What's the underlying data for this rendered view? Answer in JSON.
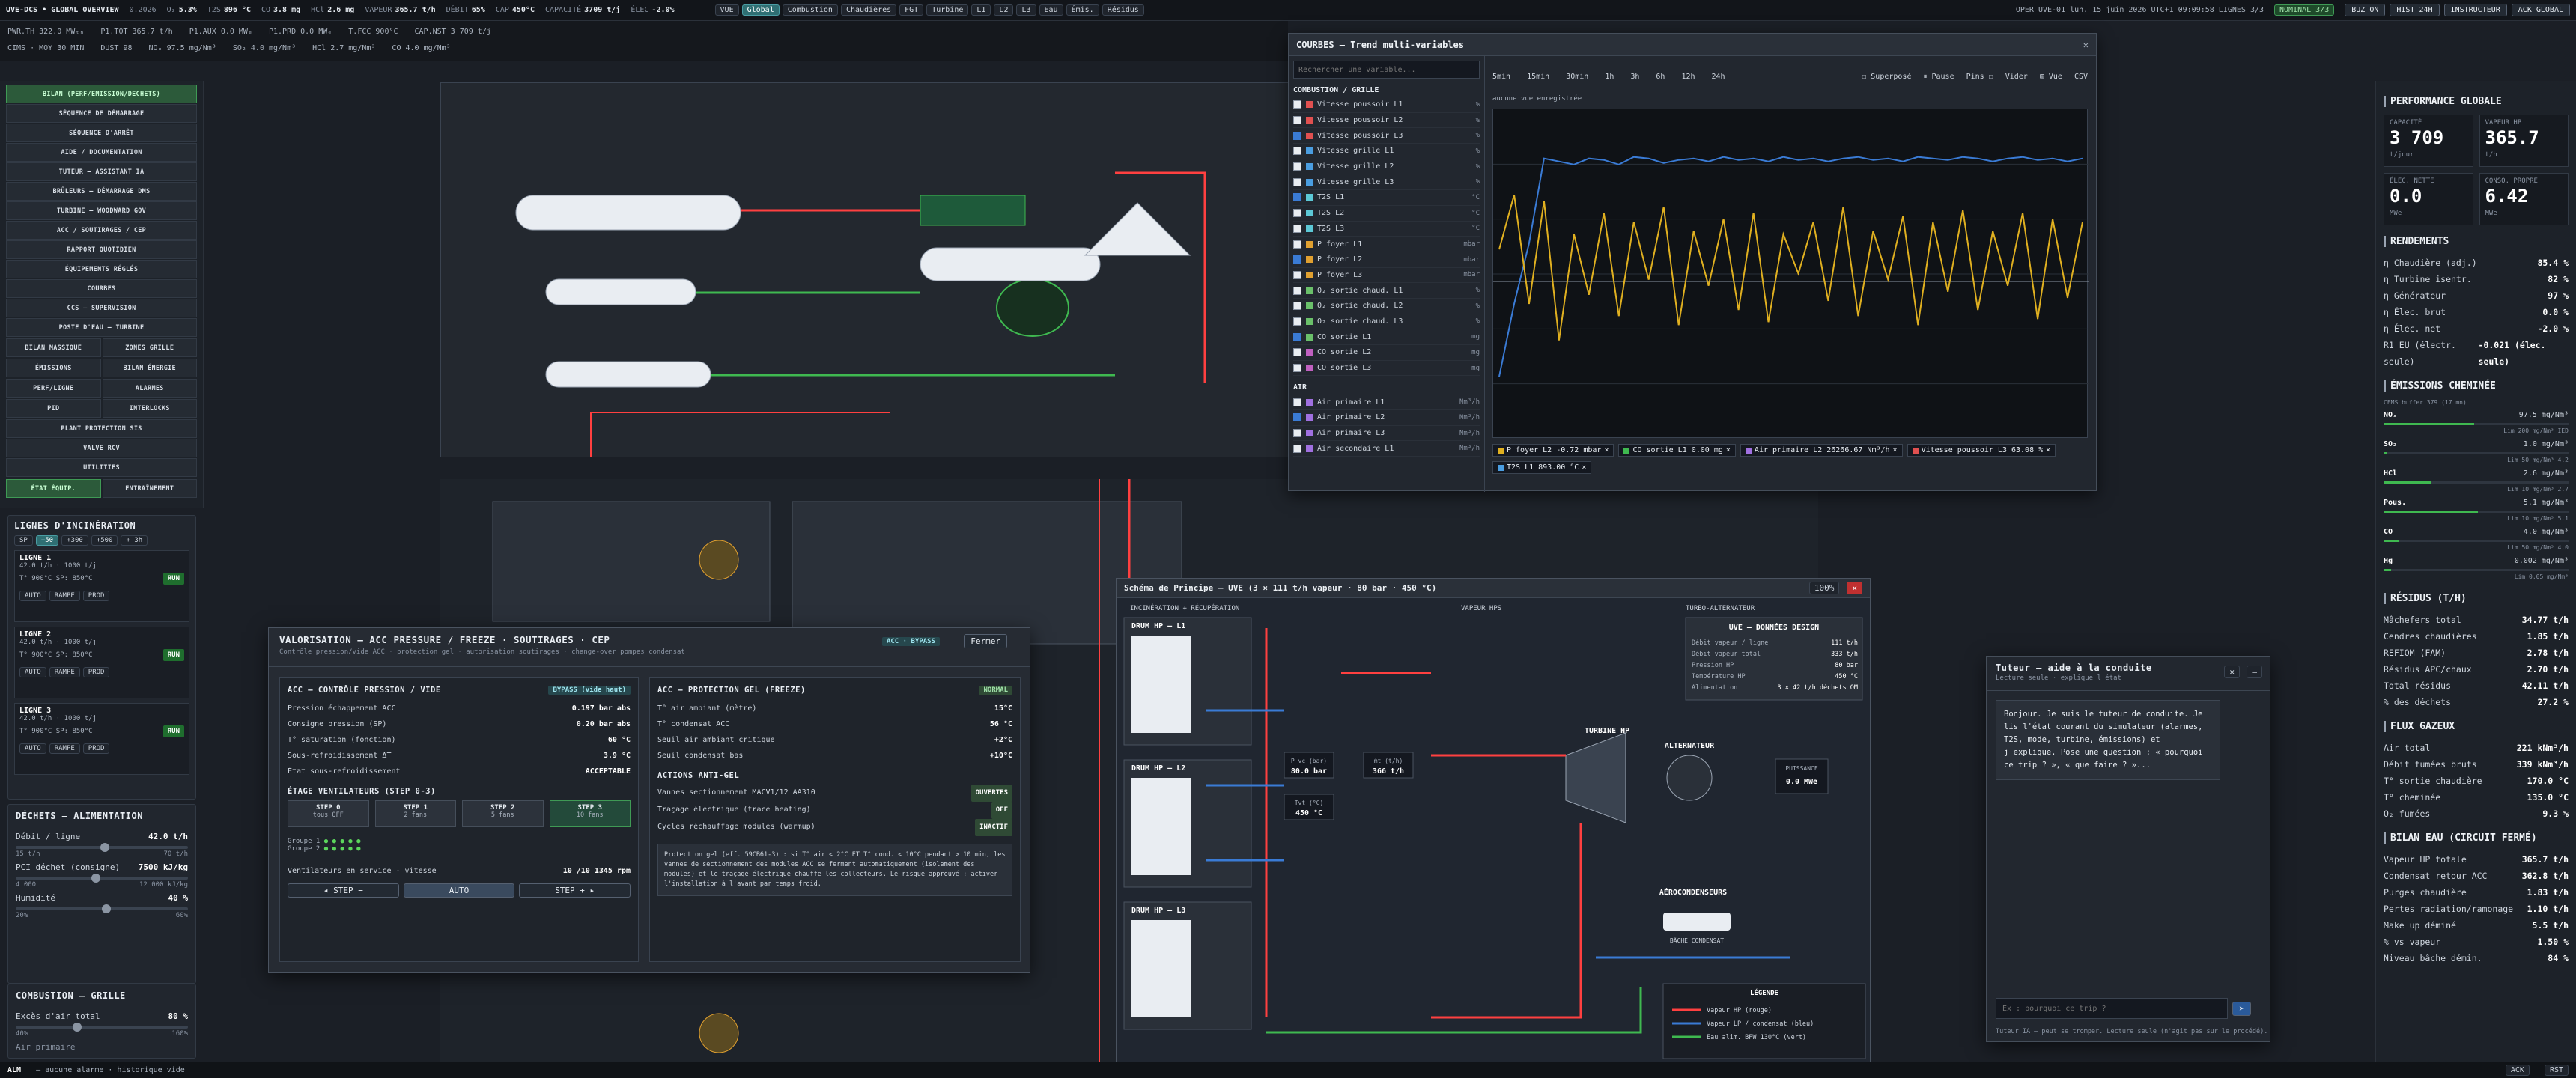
{
  "topbar": {
    "title": "UVE-DCS • GLOBAL OVERVIEW",
    "version": "0.2026",
    "kpis": [
      {
        "k": "O₂",
        "v": "5.3%"
      },
      {
        "k": "T2S",
        "v": "896 °C"
      },
      {
        "k": "CO",
        "v": "3.8 mg"
      },
      {
        "k": "HCl",
        "v": "2.6 mg"
      },
      {
        "k": "VAPEUR",
        "v": "365.7 t/h"
      },
      {
        "k": "DÉBIT",
        "v": "65%"
      },
      {
        "k": "CAP",
        "v": "450°C"
      },
      {
        "k": "CAPACITÉ",
        "v": "3709 t/j"
      },
      {
        "k": "ÉLEC",
        "v": "-2.0%"
      }
    ],
    "mode_chips": [
      "VUE",
      "Global",
      "Combustion",
      "Chaudières",
      "FGT",
      "Turbine",
      "L1",
      "L2",
      "L3",
      "Eau",
      "Émis.",
      "Résidus"
    ],
    "status": "OPER UVE-01  lun. 15 juin 2026  UTC+1 09:09:58  LIGNES 3/3",
    "nominal": "NOMINAL 3/3",
    "buttons": [
      "BUZ ON",
      "HIST 24H",
      "INSTRUCTEUR",
      "ACK GLOBAL"
    ]
  },
  "bar2": {
    "row1": [
      "PWR.TH 322.0 MWₜₕ",
      "P1.TOT 365.7 t/h",
      "P1.AUX 0.0 MWₑ",
      "P1.PRD 0.0 MWₑ",
      "T.FCC 900°C",
      "CAP.NST 3 709 t/j"
    ],
    "row2": [
      "CIMS · MOY 30 MIN",
      "DUST 98",
      "NOₓ 97.5 mg/Nm³",
      "SO₂ 4.0 mg/Nm³",
      "HCl 2.7 mg/Nm³",
      "CO 4.0 mg/Nm³"
    ]
  },
  "leftnav": {
    "items": [
      "BILAN (PERF/EMISSION/DECHETS)",
      "SÉQUENCE DE DÉMARRAGE",
      "SÉQUENCE D'ARRÊT",
      "AIDE / DOCUMENTATION",
      "TUTEUR — ASSISTANT IA",
      "BRÛLEURS — DÉMARRAGE DMS",
      "TURBINE — WOODWARD GOV",
      "ACC / SOUTIRAGES / CEP",
      "RAPPORT QUOTIDIEN",
      "ÉQUIPEMENTS RÉGLÉS",
      "COURBES",
      "CCS — SUPERVISION",
      "POSTE D'EAU — TURBINE"
    ],
    "pairs": [
      [
        "BILAN MASSIQUE",
        "ZONES GRILLE"
      ],
      [
        "ÉMISSIONS",
        "BILAN ÉNERGIE"
      ],
      [
        "PERF/LIGNE",
        "ALARMES"
      ],
      [
        "PID",
        "INTERLOCKS"
      ]
    ],
    "items2": [
      "PLANT PROTECTION SIS",
      "VALVE RCV",
      "UTILITIES"
    ],
    "tabs": [
      "ÉTAT ÉQUIP.",
      "ENTRAÎNEMENT"
    ]
  },
  "lines": {
    "title": "LIGNES D'INCINÉRATION",
    "chips": [
      "SP",
      "+50",
      "+300",
      "+500",
      "+ 3h"
    ],
    "cards": [
      {
        "name": "LIGNE 1",
        "info": "42.0 t/h · 1000 t/j",
        "t": "T° 900°C  SP: 850°C",
        "run": "RUN"
      },
      {
        "name": "LIGNE 2",
        "info": "42.0 t/h · 1000 t/j",
        "t": "T° 900°C  SP: 850°C",
        "run": "RUN"
      },
      {
        "name": "LIGNE 3",
        "info": "42.0 t/h · 1000 t/j",
        "t": "T° 900°C  SP: 850°C",
        "run": "RUN"
      }
    ],
    "modes": [
      "AUTO",
      "RAMPE",
      "PROD"
    ]
  },
  "dechets": {
    "title": "DÉCHETS — ALIMENTATION",
    "rows": [
      {
        "label": "Débit / ligne",
        "value": "42.0 t/h",
        "min": "15 t/h",
        "max": "70 t/h"
      },
      {
        "label": "PCI déchet (consigne)",
        "value": "7500 kJ/kg",
        "min": "4 000",
        "max": "12 000 kJ/kg"
      },
      {
        "label": "Humidité",
        "value": "40 %",
        "min": "20%",
        "max": "60%"
      }
    ]
  },
  "combustion": {
    "title": "COMBUSTION — GRILLE",
    "rows": [
      {
        "label": "Excès d'air total",
        "value": "80 %",
        "min": "40%",
        "max": "160%"
      }
    ],
    "last": "Air primaire"
  },
  "right": {
    "perf_title": "PERFORMANCE GLOBALE",
    "kpis": [
      {
        "label": "CAPACITÉ",
        "value": "3 709",
        "unit": "t/jour"
      },
      {
        "label": "VAPEUR HP",
        "value": "365.7",
        "unit": "t/h"
      },
      {
        "label": "ÉLEC. NETTE",
        "value": "0.0",
        "unit": "MWe"
      },
      {
        "label": "CONSO. PROPRE",
        "value": "6.42",
        "unit": "MWe"
      }
    ],
    "rend_title": "RENDEMENTS",
    "rend": [
      [
        "η Chaudière (adj.)",
        "85.4 %"
      ],
      [
        "η Turbine isentr.",
        "82 %"
      ],
      [
        "η Générateur",
        "97 %"
      ],
      [
        "η Élec. brut",
        "0.0 %"
      ],
      [
        "η Élec. net",
        "-2.0 %"
      ],
      [
        "R1 EU (électr. seule)",
        "-0.021 (élec. seule)"
      ]
    ],
    "em_title": "ÉMISSIONS CHEMINÉE",
    "em_sub": "CEMS buffer 379 (17 mn)",
    "em": [
      {
        "k": "NOₓ",
        "v": "97.5 mg/Nm³",
        "lim": "Lim 200 mg/Nm³ IED",
        "fill": 0.49
      },
      {
        "k": "SO₂",
        "v": "1.0 mg/Nm³",
        "lim": "Lim 50 mg/Nm³ 4.2",
        "fill": 0.02
      },
      {
        "k": "HCl",
        "v": "2.6 mg/Nm³",
        "lim": "Lim 10 mg/Nm³ 2.7",
        "fill": 0.26
      },
      {
        "k": "Pous.",
        "v": "5.1 mg/Nm³",
        "lim": "Lim 10 mg/Nm³ 5.1",
        "fill": 0.51
      },
      {
        "k": "CO",
        "v": "4.0 mg/Nm³",
        "lim": "Lim 50 mg/Nm³ 4.0",
        "fill": 0.08
      },
      {
        "k": "Hg",
        "v": "0.002 mg/Nm³",
        "lim": "Lim 0.05 mg/Nm³",
        "fill": 0.04
      }
    ],
    "res_title": "RÉSIDUS (T/H)",
    "res": [
      [
        "Mâchefers total",
        "34.77 t/h"
      ],
      [
        "Cendres chaudières",
        "1.85 t/h"
      ],
      [
        "REFIOM (FAM)",
        "2.78 t/h"
      ],
      [
        "Résidus APC/chaux",
        "2.70 t/h"
      ],
      [
        "Total résidus",
        "42.11 t/h"
      ],
      [
        "% des déchets",
        "27.2 %"
      ]
    ],
    "flux_title": "FLUX GAZEUX",
    "flux": [
      [
        "Air total",
        "221 kNm³/h"
      ],
      [
        "Débit fumées bruts",
        "339 kNm³/h"
      ],
      [
        "T° sortie chaudière",
        "170.0 °C"
      ],
      [
        "T° cheminée",
        "135.0 °C"
      ],
      [
        "O₂ fumées",
        "9.3 %"
      ]
    ],
    "bilan_title": "BILAN EAU (CIRCUIT FERMÉ)",
    "bilan": [
      [
        "Vapeur HP totale",
        "365.7 t/h"
      ],
      [
        "Condensat retour ACC",
        "362.8 t/h"
      ],
      [
        "Purges chaudière",
        "1.83 t/h"
      ],
      [
        "Pertes radiation/ramonage",
        "1.10 t/h"
      ],
      [
        "Make up déminé",
        "5.5 t/h"
      ],
      [
        "% vs vapeur",
        "1.50 %"
      ],
      [
        "Niveau bâche démin.",
        "84 %"
      ]
    ]
  },
  "trend": {
    "title": "COURBES — Trend multi-variables",
    "search_placeholder": "Rechercher une variable...",
    "time_buttons": [
      "5min",
      "15min",
      "30min",
      "1h",
      "3h",
      "6h",
      "12h",
      "24h"
    ],
    "actions": [
      "☐ Superposé",
      "⏸ Pause",
      "Pins ☐",
      "Vider",
      "⊞ Vue",
      "CSV"
    ],
    "no_data": "aucune vue enregistrée",
    "groups": [
      {
        "name": "COMBUSTION / GRILLE",
        "vars": [
          {
            "n": "Vitesse poussoir L1",
            "u": "%",
            "c": "#e05050",
            "on": false
          },
          {
            "n": "Vitesse poussoir L2",
            "u": "%",
            "c": "#e05050",
            "on": false
          },
          {
            "n": "Vitesse poussoir L3",
            "u": "%",
            "c": "#e05050",
            "on": true
          },
          {
            "n": "Vitesse grille L1",
            "u": "%",
            "c": "#4a9de0",
            "on": false
          },
          {
            "n": "Vitesse grille L2",
            "u": "%",
            "c": "#4a9de0",
            "on": false
          },
          {
            "n": "Vitesse grille L3",
            "u": "%",
            "c": "#4a9de0",
            "on": false
          },
          {
            "n": "T2S L1",
            "u": "°C",
            "c": "#5cc8d6",
            "on": true
          },
          {
            "n": "T2S L2",
            "u": "°C",
            "c": "#5cc8d6",
            "on": false
          },
          {
            "n": "T2S L3",
            "u": "°C",
            "c": "#5cc8d6",
            "on": false
          },
          {
            "n": "P foyer L1",
            "u": "mbar",
            "c": "#e0a030",
            "on": false
          },
          {
            "n": "P foyer L2",
            "u": "mbar",
            "c": "#e0a030",
            "on": true
          },
          {
            "n": "P foyer L3",
            "u": "mbar",
            "c": "#e0a030",
            "on": false
          },
          {
            "n": "O₂ sortie chaud. L1",
            "u": "%",
            "c": "#6ac06a",
            "on": false
          },
          {
            "n": "O₂ sortie chaud. L2",
            "u": "%",
            "c": "#6ac06a",
            "on": false
          },
          {
            "n": "O₂ sortie chaud. L3",
            "u": "%",
            "c": "#6ac06a",
            "on": false
          },
          {
            "n": "CO sortie L1",
            "u": "mg",
            "c": "#6ac06a",
            "on": true
          },
          {
            "n": "CO sortie L2",
            "u": "mg",
            "c": "#c060c0",
            "on": false
          },
          {
            "n": "CO sortie L3",
            "u": "mg",
            "c": "#c060c0",
            "on": false
          }
        ]
      },
      {
        "name": "AIR",
        "vars": [
          {
            "n": "Air primaire L1",
            "u": "Nm³/h",
            "c": "#a070e0",
            "on": false
          },
          {
            "n": "Air primaire L2",
            "u": "Nm³/h",
            "c": "#a070e0",
            "on": true
          },
          {
            "n": "Air primaire L3",
            "u": "Nm³/h",
            "c": "#a070e0",
            "on": false
          },
          {
            "n": "Air secondaire L1",
            "u": "Nm³/h",
            "c": "#a070e0",
            "on": false
          }
        ]
      }
    ],
    "legend": [
      {
        "t": "P foyer L2 -0.72 mbar",
        "c": "#e0b020"
      },
      {
        "t": "CO sortie L1 0.00 mg",
        "c": "#3fb950"
      },
      {
        "t": "Air primaire L2 26266.67 Nm³/h",
        "c": "#a070e0"
      },
      {
        "t": "Vitesse poussoir L3 63.08 %",
        "c": "#e05050"
      },
      {
        "t": "T2S L1 893.00 °C",
        "c": "#4a9de0"
      }
    ]
  },
  "chart_data": {
    "type": "line",
    "title": "",
    "series": [
      {
        "name": "T2S L1",
        "values": [
          180,
          420,
          620,
          900,
          890,
          880,
          900,
          895,
          880,
          905,
          900,
          885,
          895,
          900,
          890,
          905,
          895,
          900,
          890,
          905,
          895,
          900,
          890,
          900,
          905,
          895,
          900,
          890,
          905,
          900,
          895,
          905,
          900,
          890,
          900,
          905,
          895,
          900,
          890,
          900
        ]
      },
      {
        "name": "P foyer L2",
        "values": [
          600,
          780,
          420,
          760,
          300,
          650,
          450,
          720,
          380,
          690,
          500,
          740,
          350,
          660,
          480,
          700,
          400,
          720,
          360,
          650,
          520,
          690,
          430,
          740,
          380,
          660,
          500,
          710,
          350,
          690,
          460,
          730,
          400,
          660,
          480,
          720,
          370,
          700,
          440,
          690
        ]
      }
    ]
  },
  "valo": {
    "title": "VALORISATION — ACC PRESSURE / FREEZE · SOUTIRAGES · CEP",
    "subtitle": "Contrôle pression/vide ACC · protection gel · autorisation soutirages · change-over pompes condensat",
    "badge": "ACC · BYPASS",
    "close": "Fermer",
    "left_title": "ACC — CONTRÔLE PRESSION / VIDE",
    "left_badge": "BYPASS (vide haut)",
    "left_rows": [
      [
        "Pression échappement ACC",
        "0.197 bar abs"
      ],
      [
        "Consigne pression (SP)",
        "0.20 bar abs"
      ],
      [
        "T° saturation (fonction)",
        "60 °C"
      ],
      [
        "Sous-refroidissement ΔT",
        "3.9 °C"
      ],
      [
        "État sous-refroidissement",
        "ACCEPTABLE"
      ]
    ],
    "step_title": "ÉTAGE VENTILATEURS (STEP 0-3)",
    "steps": [
      [
        "STEP 0",
        "tous OFF"
      ],
      [
        "STEP 1",
        "2 fans"
      ],
      [
        "STEP 2",
        "5 fans"
      ],
      [
        "STEP 3",
        "10 fans"
      ]
    ],
    "fans": "Ventilateurs en service · vitesse",
    "fans_val": "10 /10  1345 rpm",
    "nav": [
      "◂ STEP −",
      "AUTO",
      "STEP + ▸"
    ],
    "right_title": "ACC — PROTECTION GEL (FREEZE)",
    "right_badge": "NORMAL",
    "right_rows": [
      [
        "T° air ambiant (mètre)",
        "15°C"
      ],
      [
        "T° condensat ACC",
        "56 °C"
      ],
      [
        "Seuil air ambiant critique",
        "+2°C"
      ],
      [
        "Seuil condensat bas",
        "+10°C"
      ]
    ],
    "anti_title": "ACTIONS ANTI-GEL",
    "anti": [
      [
        "Vannes sectionnement MACV1/12 AA310",
        "OUVERTES"
      ],
      [
        "Traçage électrique (trace heating)",
        "OFF"
      ],
      [
        "Cycles réchauffage modules (warmup)",
        "INACTIF"
      ]
    ],
    "note": "Protection gel (eff. 59CB61-3) : si T° air < 2°C ET T° cond. < 10°C pendant > 10 min, les vannes de sectionnement des modules ACC se ferment automatiquement (isolement des modules) et le traçage électrique chauffe les collecteurs. Le risque approuvé : activer l'installation à l'avant par temps froid."
  },
  "schema": {
    "title": "Schéma de Principe — UVE (3 × 111 t/h vapeur · 80 bar · 450 °C)",
    "zoom": "100%",
    "drums": [
      "DRUM HP — L1",
      "DRUM HP — L2",
      "DRUM HP — L3"
    ],
    "cols": [
      "INCINÉRATION + RÉCUPÉRATION",
      "VAPEUR HPS",
      "TURBO-ALTERNATEUR"
    ],
    "design_title": "UVE — DONNÉES DESIGN",
    "design": [
      [
        "Débit vapeur / ligne",
        "111 t/h"
      ],
      [
        "Débit vapeur total",
        "333 t/h"
      ],
      [
        "Pression HP",
        "80 bar"
      ],
      [
        "Température HP",
        "450 °C"
      ],
      [
        "Alimentation",
        "3 × 42 t/h déchets OM"
      ]
    ],
    "labels": {
      "pvc": "P vc (bar)",
      "pvcv": "80.0 bar",
      "m": "ṁt (t/h)",
      "mv": "366 t/h",
      "tv": "Tvt (°C)",
      "tvv": "450 °C",
      "turb": "TURBINE HP",
      "alt": "ALTERNATEUR",
      "puiss": "PUISSANCE",
      "pv": "0.0 MWe",
      "aero": "AÉROCONDENSEURS",
      "bache": "BÂCHE CONDENSAT",
      "legend": "LÉGENDE"
    },
    "leg": [
      "Vapeur HP (rouge)",
      "Vapeur LP / condensat (bleu)",
      "Eau alim. BFW 130°C (vert)"
    ]
  },
  "tutor": {
    "title": "Tuteur — aide à la conduite",
    "subtitle": "Lecture seule · explique l'état",
    "message": "Bonjour. Je suis le tuteur de conduite. Je lis l'état courant du simulateur (alarmes, T2S, mode, turbine, émissions) et j'explique. Pose une question : « pourquoi ce trip ? », « que faire ? »...",
    "placeholder": "Ex : pourquoi ce trip ?",
    "footer": "Tuteur IA — peut se tromper. Lecture seule (n'agit pas sur le procédé)."
  },
  "bottombar": {
    "alm": "ALM",
    "msg": "— aucune alarme · historique vide",
    "ack": "ACK",
    "rst": "RST"
  },
  "colors": {
    "accent": "#2f6f73",
    "ok": "#3fb950",
    "warn": "#ffb347",
    "alarm": "#ff5c5c",
    "steam": "#e03030",
    "water": "#3fb950"
  }
}
